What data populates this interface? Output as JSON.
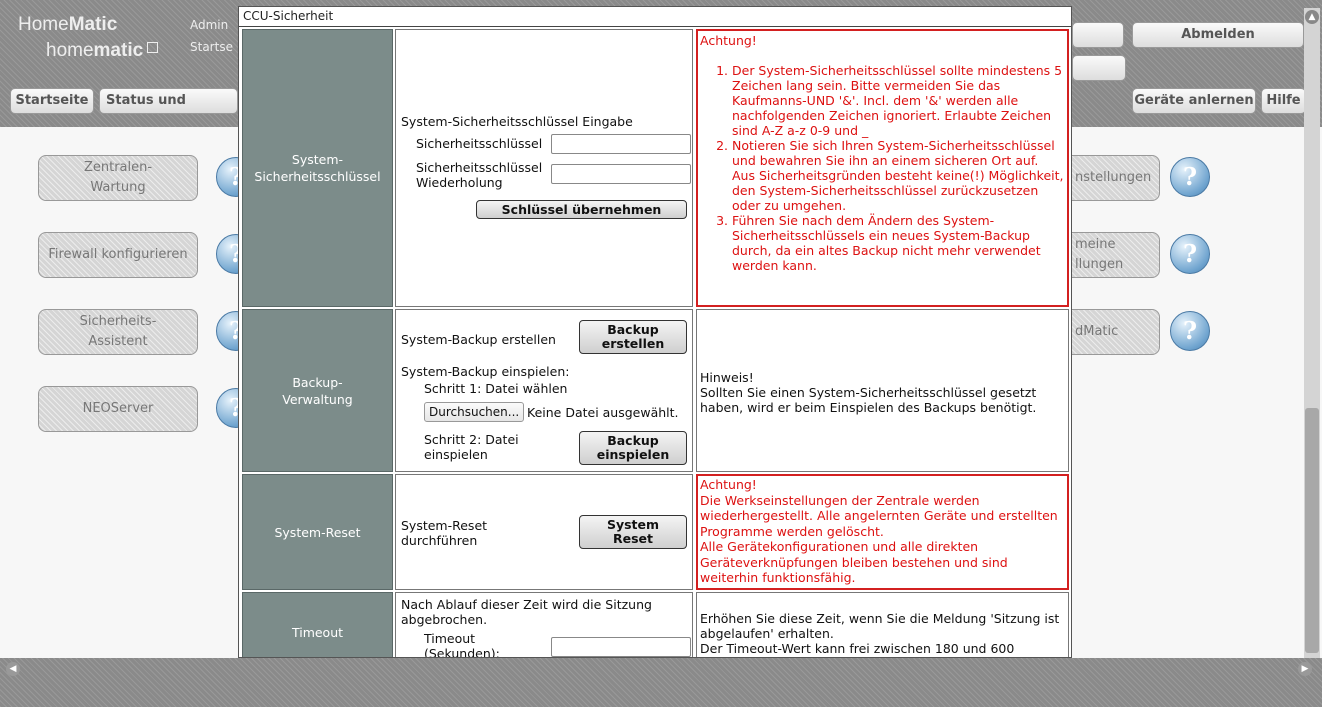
{
  "header": {
    "logo_main_part1": "Home",
    "logo_main_part2": "Matic",
    "logo_sub_part1": "home",
    "logo_sub_part2": "matic",
    "user": "Admin",
    "page_label": "Startse",
    "logout_label": "Abmelden",
    "nav_tabs": [
      "Startseite",
      "Status und Bedienur"
    ],
    "teach_devices_label": "Geräte anlernen",
    "help_label": "Hilfe"
  },
  "main_buttons": {
    "left": [
      "Zentralen-\nWartung",
      "Firewall konfigurieren",
      "Sicherheits-\nAssistent",
      "NEOServer"
    ],
    "right": [
      "nstellungen",
      "meine\nllungen",
      "dMatic"
    ]
  },
  "help_icon_glyph": "?",
  "dialog": {
    "title": "CCU-Sicherheit",
    "key_section": {
      "label": "System-\nSicherheitsschlüssel",
      "heading": "System-Sicherheitsschlüssel Eingabe",
      "key_label": "Sicherheitsschlüssel",
      "key_value": "",
      "repeat_label": "Sicherheitsschlüssel\nWiederholung",
      "repeat_value": "",
      "apply_button": "Schlüssel übernehmen",
      "warning_title": "Achtung!",
      "warnings": [
        "Der System-Sicherheitsschlüssel sollte mindestens 5 Zeichen lang sein. Bitte vermeiden Sie das Kaufmanns-UND '&'. Incl. dem '&' werden alle nachfolgenden Zeichen ignoriert. Erlaubte Zeichen sind A-Z a-z 0-9 und _",
        "Notieren Sie sich Ihren System-Sicherheitsschlüssel und bewahren Sie ihn an einem sicheren Ort auf.\nAus Sicherheitsgründen besteht keine(!) Möglichkeit, den System-Sicherheitsschlüssel zurückzusetzen oder zu umgehen.",
        "Führen Sie nach dem Ändern des System-Sicherheitsschlüssels ein neues System-Backup durch, da ein altes Backup nicht mehr verwendet werden kann."
      ]
    },
    "backup_section": {
      "label": "Backup-\nVerwaltung",
      "create_label": "System-Backup erstellen",
      "create_button": "Backup\nerstellen",
      "restore_heading": "System-Backup einspielen:",
      "step1": "Schritt 1: Datei wählen",
      "browse_button": "Durchsuchen...",
      "no_file": "Keine Datei ausgewählt.",
      "step2": "Schritt 2: Datei\neinspielen",
      "restore_button": "Backup\neinspielen",
      "hint": "Hinweis!\nSollten Sie einen System-Sicherheitsschlüssel gesetzt haben, wird er beim Einspielen des Backups benötigt."
    },
    "reset_section": {
      "label": "System-Reset",
      "text": "System-Reset\ndurchführen",
      "button": "System\nReset",
      "warning": "Achtung!\nDie Werkseinstellungen der Zentrale werden wiederhergestellt. Alle angelernten Geräte und erstellten Programme werden gelöscht.\nAlle Gerätekonfigurationen und alle direkten Geräteverknüpfungen bleiben bestehen und sind weiterhin funktionsfähig."
    },
    "timeout_section": {
      "label": "Timeout",
      "text": "Nach Ablauf dieser Zeit wird die Sitzung abgebrochen.",
      "field_label": "Timeout\n(Sekunden):",
      "field_value": "",
      "hint": "Erhöhen Sie diese Zeit, wenn Sie die Meldung 'Sitzung ist abgelaufen' erhalten.\nDer Timeout-Wert kann frei zwischen 180 und 600"
    }
  }
}
